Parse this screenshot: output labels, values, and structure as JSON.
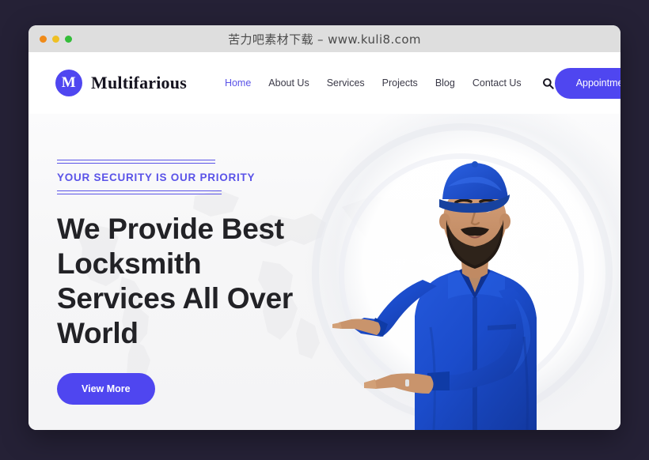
{
  "window": {
    "title": "苦力吧素材下载 – www.kuli8.com",
    "controls": [
      {
        "name": "close",
        "color": "#f08a18"
      },
      {
        "name": "minimize",
        "color": "#efc024"
      },
      {
        "name": "maximize",
        "color": "#34bd3a"
      }
    ]
  },
  "colors": {
    "accent": "#4f46f0",
    "accent_text": "#5a53e8",
    "page_background": "#252136",
    "title_bar": "#dedede",
    "hero_background": "#f6f6f7",
    "heading": "#222226",
    "uniform_blue": "#1a4fd0"
  },
  "header": {
    "brand": {
      "mark_letter": "M",
      "name": "Multifarious"
    },
    "nav": [
      {
        "label": "Home",
        "active": true
      },
      {
        "label": "About Us",
        "active": false
      },
      {
        "label": "Services",
        "active": false
      },
      {
        "label": "Projects",
        "active": false
      },
      {
        "label": "Blog",
        "active": false
      },
      {
        "label": "Contact Us",
        "active": false
      }
    ],
    "search_icon": "search-icon",
    "cta_label": "Appointment"
  },
  "hero": {
    "eyebrow": "YOUR SECURITY IS OUR PRIORITY",
    "title": "We Provide Best Locksmith Services All Over World",
    "cta_label": "View More",
    "figure_alt": "bearded locksmith worker in blue uniform and cap pointing with both hands",
    "background_motif": "faint world map silhouette"
  }
}
